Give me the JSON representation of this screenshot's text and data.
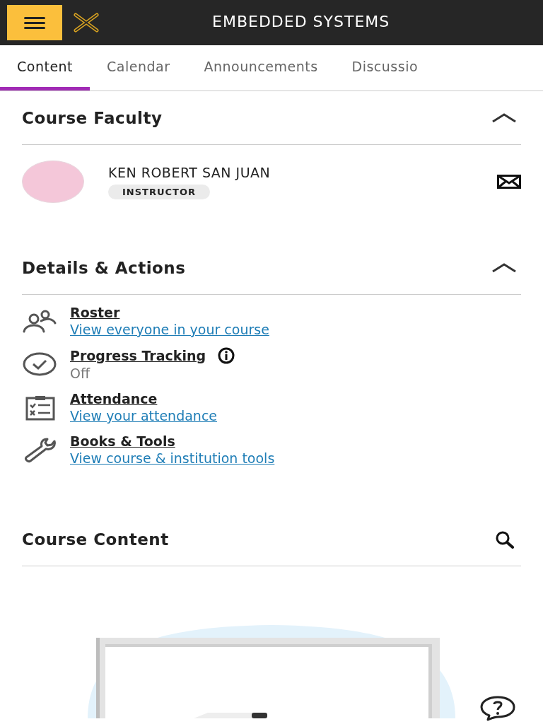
{
  "header": {
    "title": "EMBEDDED SYSTEMS"
  },
  "tabs": [
    {
      "label": "Content",
      "selected": true
    },
    {
      "label": "Calendar",
      "selected": false
    },
    {
      "label": "Announcements",
      "selected": false
    },
    {
      "label": "Discussio",
      "selected": false
    }
  ],
  "faculty": {
    "heading": "Course Faculty",
    "expanded": true,
    "name": "KEN ROBERT SAN JUAN",
    "role": "INSTRUCTOR"
  },
  "details": {
    "heading": "Details & Actions",
    "expanded": true,
    "items": [
      {
        "kind": "roster",
        "title": "Roster",
        "subtitle": "View everyone in your course",
        "subtitle_link": true,
        "info": false
      },
      {
        "kind": "progress",
        "title": "Progress Tracking",
        "subtitle": "Off",
        "subtitle_link": false,
        "info": true
      },
      {
        "kind": "attendance",
        "title": "Attendance",
        "subtitle": "View your attendance",
        "subtitle_link": true,
        "info": false
      },
      {
        "kind": "tools",
        "title": "Books & Tools",
        "subtitle": "View course & institution tools",
        "subtitle_link": true,
        "info": false
      }
    ]
  },
  "content": {
    "heading": "Course Content"
  }
}
